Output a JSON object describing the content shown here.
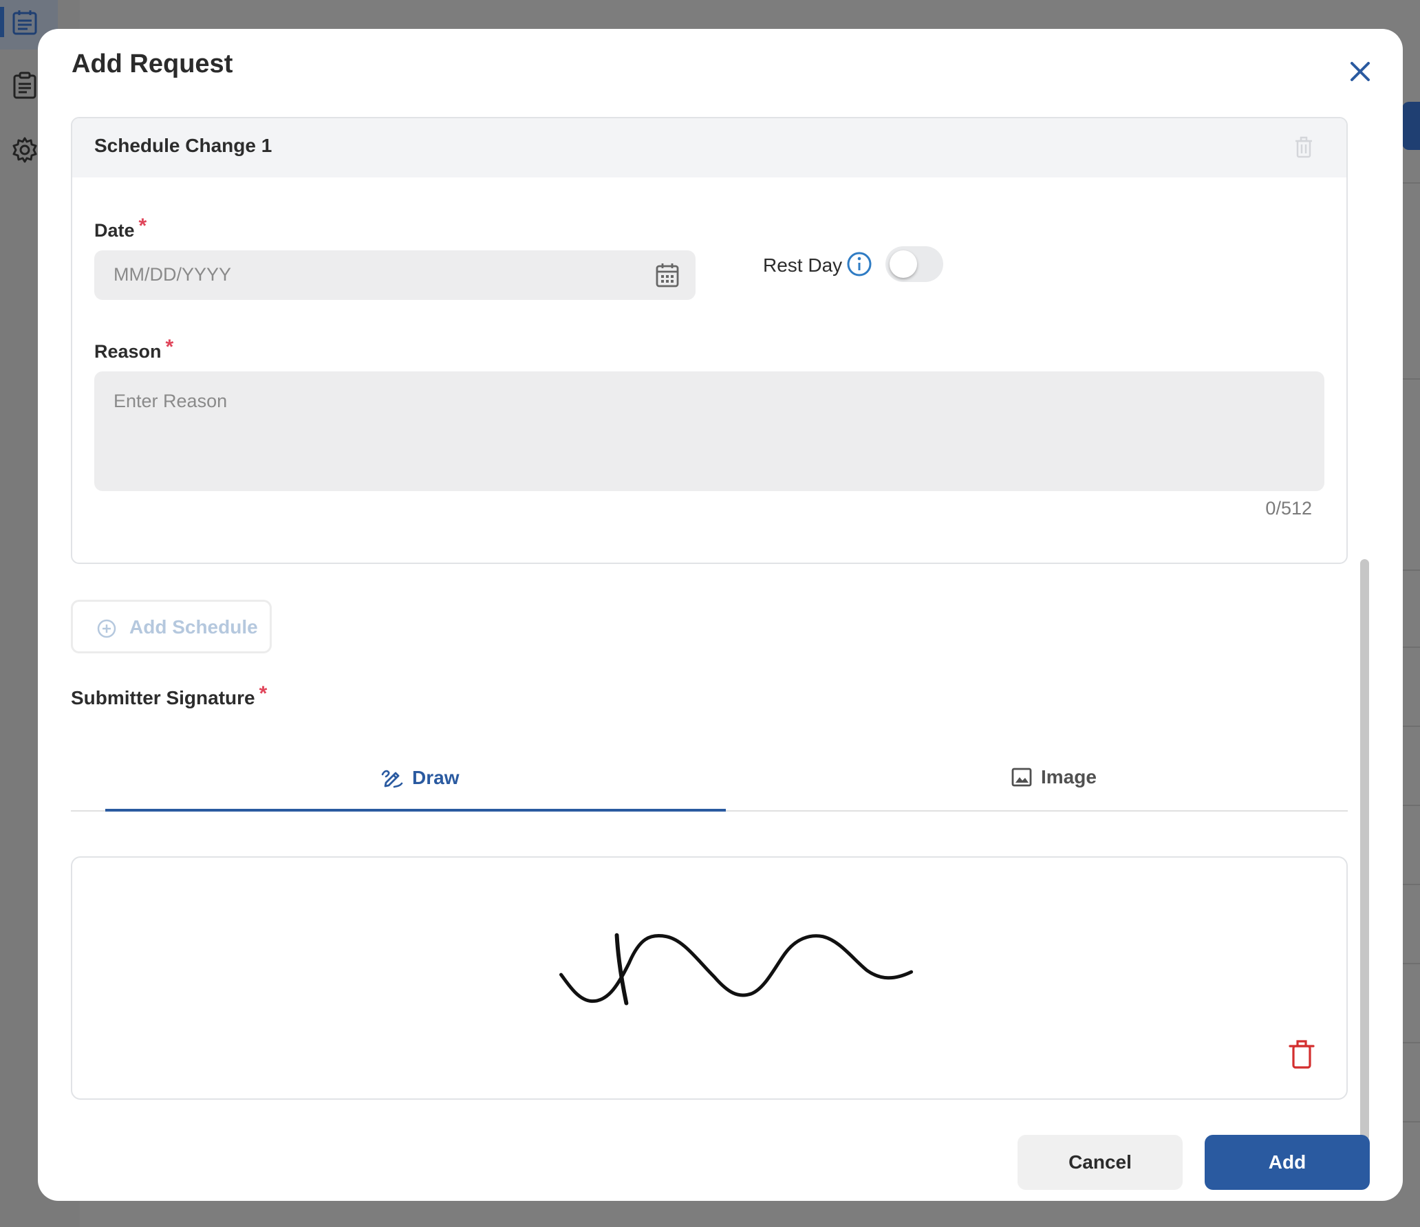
{
  "modal": {
    "title": "Add Request",
    "close_icon": "close-icon"
  },
  "schedule_card": {
    "title": "Schedule Change 1",
    "delete_icon": "trash-icon",
    "date": {
      "label": "Date",
      "required_mark": "*",
      "placeholder": "MM/DD/YYYY",
      "value": "",
      "icon": "calendar-icon"
    },
    "rest_day": {
      "label": "Rest Day",
      "info_icon": "info-icon",
      "enabled": false
    },
    "reason": {
      "label": "Reason",
      "required_mark": "*",
      "placeholder": "Enter Reason",
      "value": "",
      "char_count": "0/512"
    }
  },
  "add_schedule": {
    "label": "Add Schedule",
    "icon": "plus-circle-icon"
  },
  "signature": {
    "label": "Submitter Signature",
    "required_mark": "*",
    "tabs": [
      {
        "label": "Draw",
        "icon": "pencil-draw-icon",
        "active": true
      },
      {
        "label": "Image",
        "icon": "image-icon",
        "active": false
      }
    ],
    "clear_icon": "trash-icon"
  },
  "footer": {
    "cancel_label": "Cancel",
    "add_label": "Add"
  },
  "colors": {
    "accent": "#2a5aa0",
    "required": "#e0455a",
    "danger": "#d32f2f",
    "info": "#2f7cc4"
  }
}
